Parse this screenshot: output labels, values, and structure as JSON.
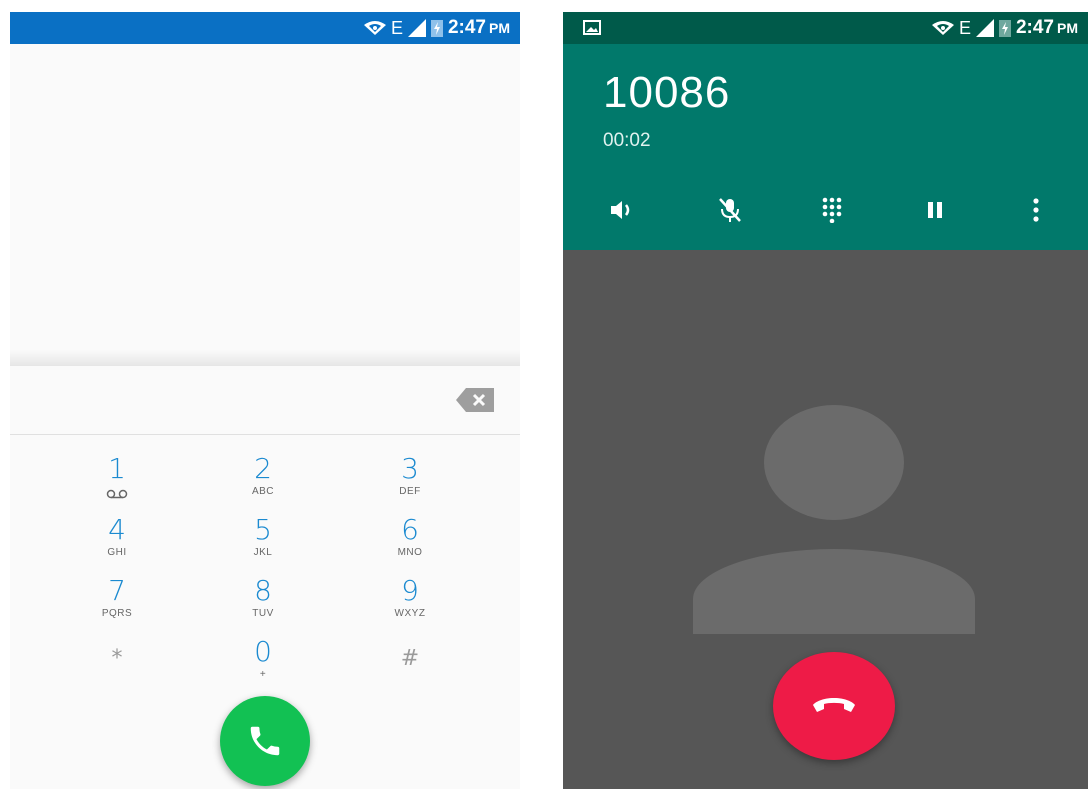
{
  "status": {
    "time": "2:47",
    "ampm": "PM",
    "network": "E"
  },
  "dialer": {
    "keys": [
      {
        "digit": "1",
        "letters": ""
      },
      {
        "digit": "2",
        "letters": "ABC"
      },
      {
        "digit": "3",
        "letters": "DEF"
      },
      {
        "digit": "4",
        "letters": "GHI"
      },
      {
        "digit": "5",
        "letters": "JKL"
      },
      {
        "digit": "6",
        "letters": "MNO"
      },
      {
        "digit": "7",
        "letters": "PQRS"
      },
      {
        "digit": "8",
        "letters": "TUV"
      },
      {
        "digit": "9",
        "letters": "WXYZ"
      },
      {
        "digit": "*",
        "letters": ""
      },
      {
        "digit": "0",
        "letters": "+"
      },
      {
        "digit": "#",
        "letters": ""
      }
    ],
    "call_button_color": "#12c153",
    "accent": "#1b8ad0",
    "statusbar_color": "#0a70c4"
  },
  "incall": {
    "number": "10086",
    "duration": "00:02",
    "header_color": "#01796b",
    "statusbar_color": "#005a4a",
    "end_button_color": "#ee1b47",
    "controls": [
      "speaker-icon",
      "mute-icon",
      "dialpad-icon",
      "hold-icon",
      "more-icon"
    ]
  }
}
